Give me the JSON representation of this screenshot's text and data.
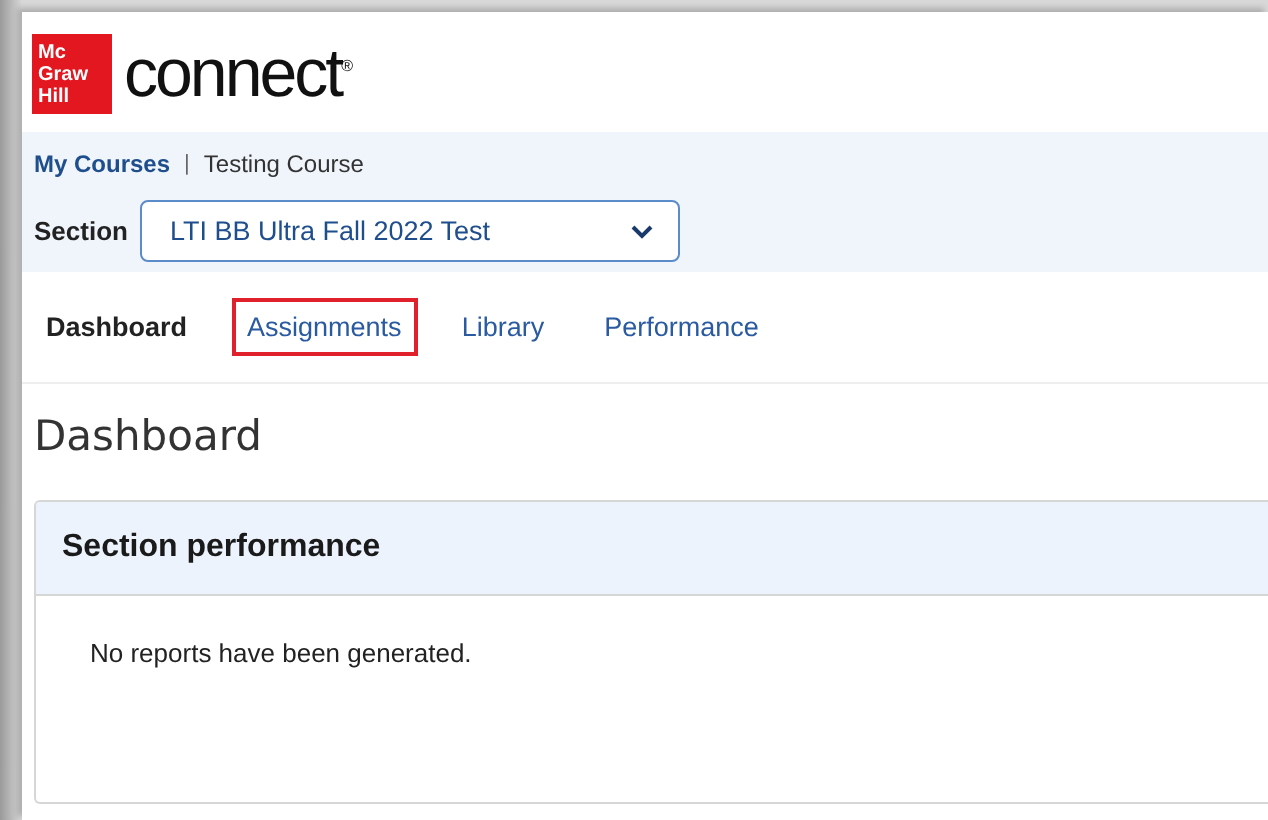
{
  "logo": {
    "badge_lines": [
      "Mc",
      "Graw",
      "Hill"
    ],
    "wordmark": "connect",
    "mark": "®"
  },
  "breadcrumb": {
    "items": [
      {
        "label": "My Courses",
        "link": true
      },
      {
        "label": "Testing Course",
        "link": false
      }
    ],
    "separator": "|"
  },
  "section": {
    "label": "Section",
    "value": "LTI BB Ultra Fall 2022 Test"
  },
  "tabs": [
    {
      "label": "Dashboard",
      "selected": true,
      "highlighted": false
    },
    {
      "label": "Assignments",
      "selected": false,
      "highlighted": true
    },
    {
      "label": "Library",
      "selected": false,
      "highlighted": false
    },
    {
      "label": "Performance",
      "selected": false,
      "highlighted": false
    }
  ],
  "heading": "Dashboard",
  "card": {
    "title": "Section performance",
    "message": "No reports have been generated."
  }
}
